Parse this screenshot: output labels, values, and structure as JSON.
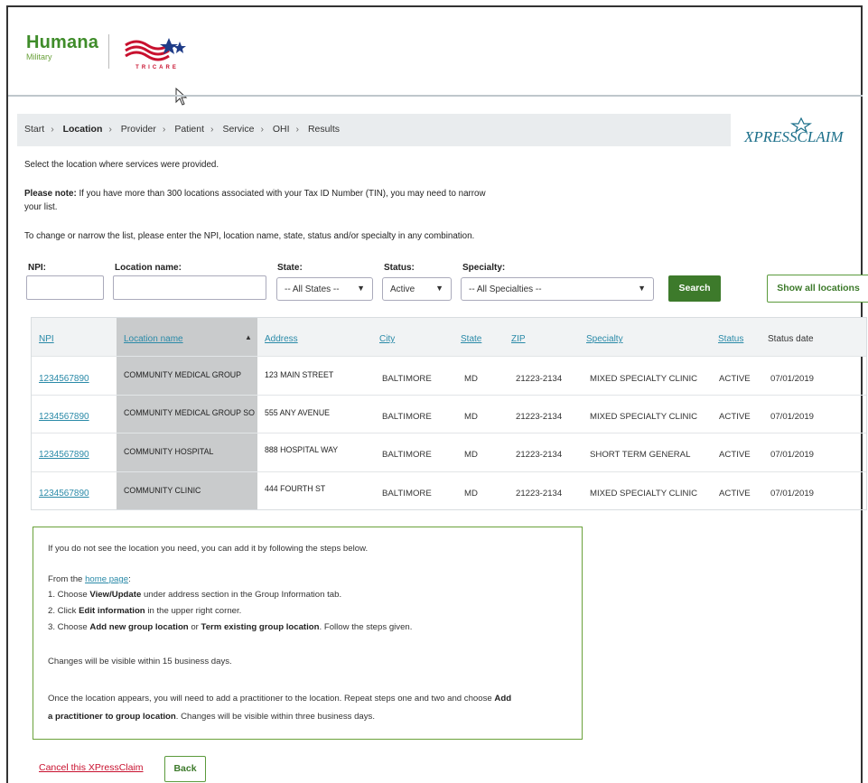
{
  "brand": {
    "name": "Humana",
    "sub": "Military",
    "partner": "TRICARE",
    "product": "XPRESSCLAIM"
  },
  "breadcrumb": [
    "Start",
    "Location",
    "Provider",
    "Patient",
    "Service",
    "OHI",
    "Results"
  ],
  "breadcrumb_active": "Location",
  "intro": {
    "line1": "Select the location where services were provided.",
    "note_label": "Please note:",
    "note_text": " If you have more than 300 locations associated with your Tax ID Number (TIN), you may need to narrow",
    "note_text2": "your list.",
    "narrow": "To change or narrow the list, please enter the NPI, location name, state, status and/or specialty in any combination."
  },
  "filters": {
    "npi_label": "NPI:",
    "npi_value": "",
    "location_label": "Location name:",
    "location_value": "",
    "state_label": "State:",
    "state_value": "-- All States --",
    "status_label": "Status:",
    "status_value": "Active",
    "specialty_label": "Specialty:",
    "specialty_value": "-- All Specialties --",
    "search_button": "Search",
    "show_all_button": "Show all locations"
  },
  "table": {
    "headers": [
      "NPI",
      "Location name",
      "Address",
      "City",
      "State",
      "ZIP",
      "Specialty",
      "Status",
      "Status date"
    ],
    "rows": [
      {
        "npi": "1234567890",
        "location": "COMMUNITY MEDICAL GROUP",
        "address": "123 MAIN STREET",
        "city": "BALTIMORE",
        "state": "MD",
        "zip": "21223-2134",
        "specialty": "MIXED SPECIALTY CLINIC",
        "status": "ACTIVE",
        "date": "07/01/2019"
      },
      {
        "npi": "1234567890",
        "location": "COMMUNITY MEDICAL GROUP SO",
        "address": "555 ANY AVENUE",
        "city": "BALTIMORE",
        "state": "MD",
        "zip": "21223-2134",
        "specialty": "MIXED SPECIALTY CLINIC",
        "status": "ACTIVE",
        "date": "07/01/2019"
      },
      {
        "npi": "1234567890",
        "location": "COMMUNITY HOSPITAL",
        "address": "888 HOSPITAL WAY",
        "city": "BALTIMORE",
        "state": "MD",
        "zip": "21223-2134",
        "specialty": "SHORT TERM GENERAL",
        "status": "ACTIVE",
        "date": "07/01/2019"
      },
      {
        "npi": "1234567890",
        "location": "COMMUNITY CLINIC",
        "address": "444 FOURTH ST",
        "city": "BALTIMORE",
        "state": "MD",
        "zip": "21223-2134",
        "specialty": "MIXED SPECIALTY CLINIC",
        "status": "ACTIVE",
        "date": "07/01/2019"
      }
    ]
  },
  "info": {
    "p1": "If you do not see the location you need, you can add it by following the steps below.",
    "from_prefix": "From the ",
    "home_link": "home page",
    "from_suffix": ":",
    "s1a": "1. Choose ",
    "s1b": "View/Update",
    "s1c": " under address section in the Group Information tab.",
    "s2a": "2. Click ",
    "s2b": "Edit information",
    "s2c": " in the upper right corner.",
    "s3a": "3. Choose ",
    "s3b": "Add new group location",
    "s3c": " or ",
    "s3d": "Term existing group location",
    "s3e": ". Follow the steps given.",
    "p3": "Changes will be visible within 15 business days.",
    "p4a": "Once the location appears, you will need to add a practitioner to the location. Repeat steps one and two and choose ",
    "p4b": "Add",
    "p4c": "a practitioner to group location",
    "p4d": ". Changes will be visible within three business days."
  },
  "footer": {
    "cancel": "Cancel this XPressClaim",
    "back": "Back"
  },
  "colors": {
    "green": "#3d7a2b",
    "link": "#2a8aa8",
    "cancel": "#c8102e"
  }
}
